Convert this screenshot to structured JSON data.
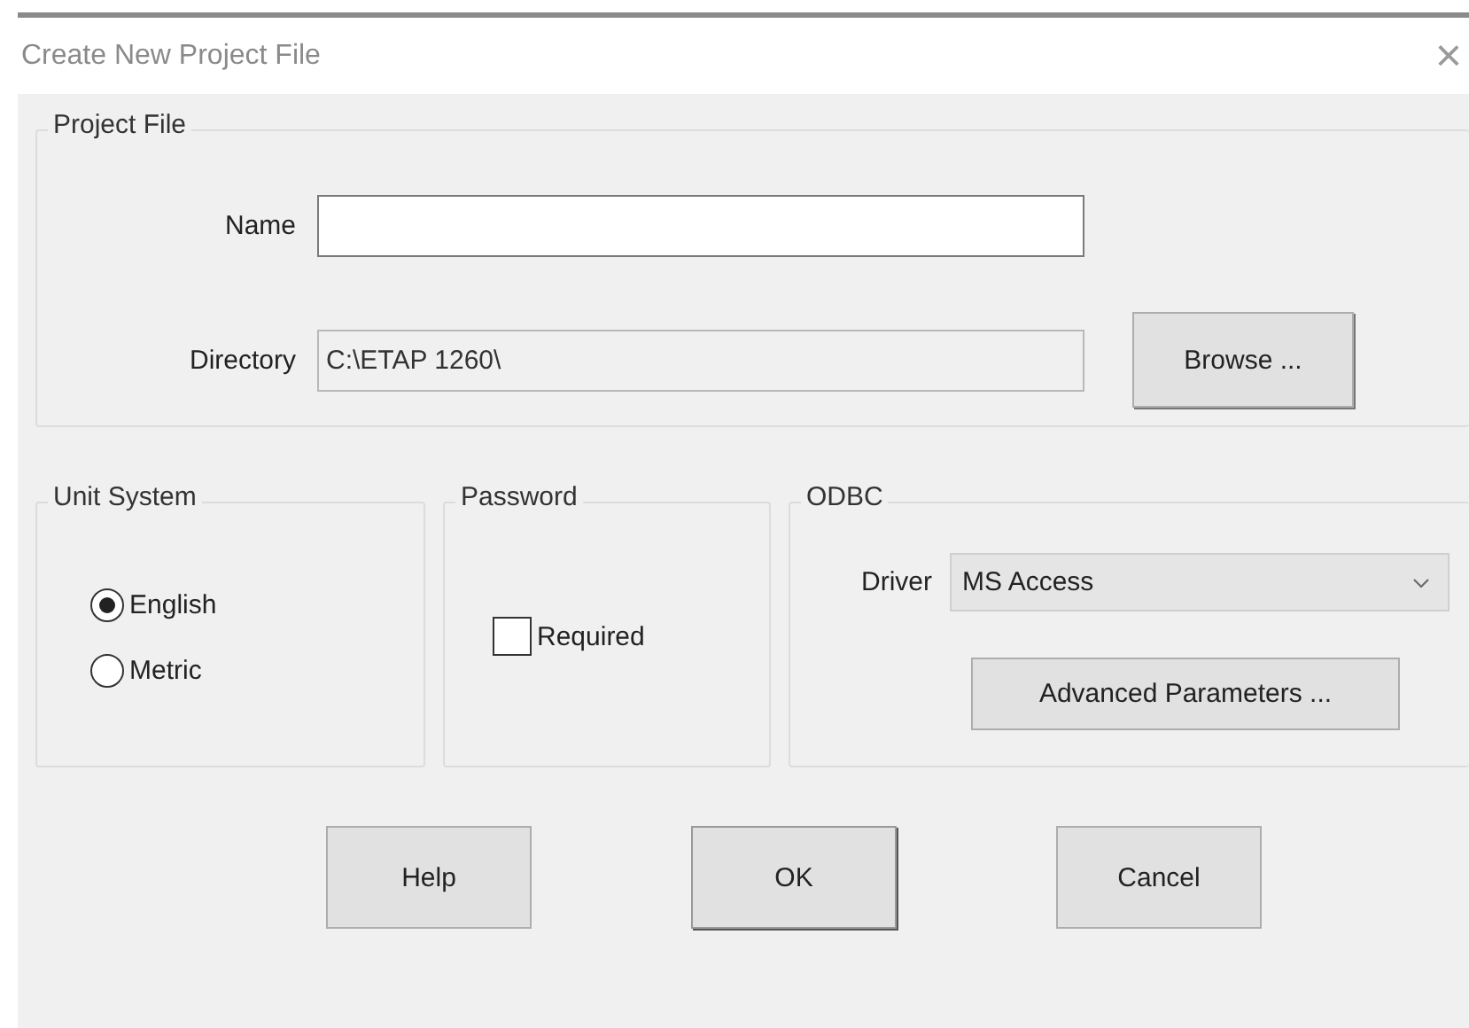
{
  "window": {
    "title": "Create New Project File",
    "close": "×"
  },
  "project_file": {
    "title": "Project File",
    "name": {
      "label": "Name"
    },
    "directory": {
      "label": "Directory",
      "value": "C:\\ETAP 1260\\",
      "disabled": true
    },
    "browse": "Browse ..."
  },
  "unit_system": {
    "title": "Unit System",
    "options": [
      {
        "label": "English",
        "selected": true
      },
      {
        "label": "Metric",
        "selected": false
      }
    ]
  },
  "password": {
    "title": "Password",
    "required": {
      "label": "Required",
      "checked": false
    }
  },
  "odbc": {
    "title": "ODBC",
    "driver": {
      "label": "Driver",
      "value": "MS Access"
    },
    "advanced": "Advanced Parameters ..."
  },
  "buttons": [
    {
      "label": "Help",
      "default": false
    },
    {
      "label": "OK",
      "default": true
    },
    {
      "label": "Cancel",
      "default": false
    }
  ]
}
